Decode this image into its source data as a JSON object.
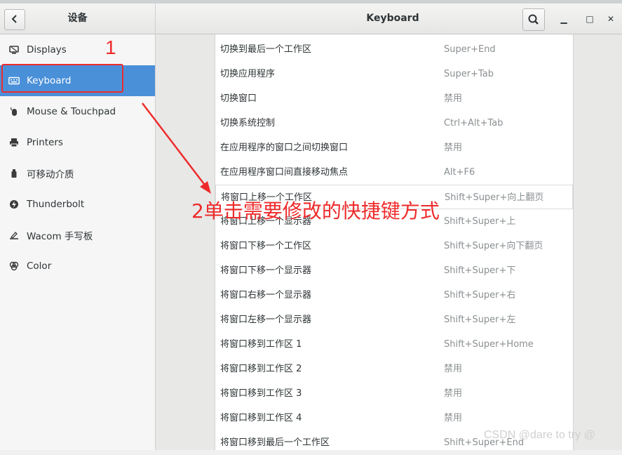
{
  "header": {
    "back_icon": "chevron-left-icon",
    "left_title": "设备",
    "title": "Keyboard",
    "search_icon": "search-icon",
    "minimize": "▁",
    "maximize": "□",
    "close": "✕"
  },
  "sidebar": {
    "items": [
      {
        "label": "Displays",
        "icon": "display-icon"
      },
      {
        "label": "Keyboard",
        "icon": "keyboard-icon",
        "active": true
      },
      {
        "label": "Mouse & Touchpad",
        "icon": "mouse-icon"
      },
      {
        "label": "Printers",
        "icon": "printer-icon"
      },
      {
        "label": "可移动介质",
        "icon": "removable-media-icon"
      },
      {
        "label": "Thunderbolt",
        "icon": "thunderbolt-icon"
      },
      {
        "label": "Wacom 手写板",
        "icon": "wacom-icon"
      },
      {
        "label": "Color",
        "icon": "color-icon"
      }
    ]
  },
  "shortcuts": [
    {
      "name": "切换到最后一个工作区",
      "key": "Super+End"
    },
    {
      "name": "切换应用程序",
      "key": "Super+Tab"
    },
    {
      "name": "切换窗口",
      "key": "禁用"
    },
    {
      "name": "切换系统控制",
      "key": "Ctrl+Alt+Tab"
    },
    {
      "name": "在应用程序的窗口之间切换窗口",
      "key": "禁用"
    },
    {
      "name": "在应用程序窗口间直接移动焦点",
      "key": "Alt+F6"
    },
    {
      "name": "将窗口上移一个工作区",
      "key": "Shift+Super+向上翻页"
    },
    {
      "name": "将窗口上移一个显示器",
      "key": "Shift+Super+上"
    },
    {
      "name": "将窗口下移一个工作区",
      "key": "Shift+Super+向下翻页"
    },
    {
      "name": "将窗口下移一个显示器",
      "key": "Shift+Super+下"
    },
    {
      "name": "将窗口右移一个显示器",
      "key": "Shift+Super+右"
    },
    {
      "name": "将窗口左移一个显示器",
      "key": "Shift+Super+左"
    },
    {
      "name": "将窗口移到工作区 1",
      "key": "Shift+Super+Home"
    },
    {
      "name": "将窗口移到工作区 2",
      "key": "禁用"
    },
    {
      "name": "将窗口移到工作区 3",
      "key": "禁用"
    },
    {
      "name": "将窗口移到工作区 4",
      "key": "禁用"
    },
    {
      "name": "将窗口移到最后一个工作区",
      "key": "Shift+Super+End"
    }
  ],
  "annotations": {
    "step1": "1",
    "step2": "2单击需要修改的快捷键方式",
    "color": "#ee2b2b"
  },
  "watermark": "CSDN @dare to try @"
}
